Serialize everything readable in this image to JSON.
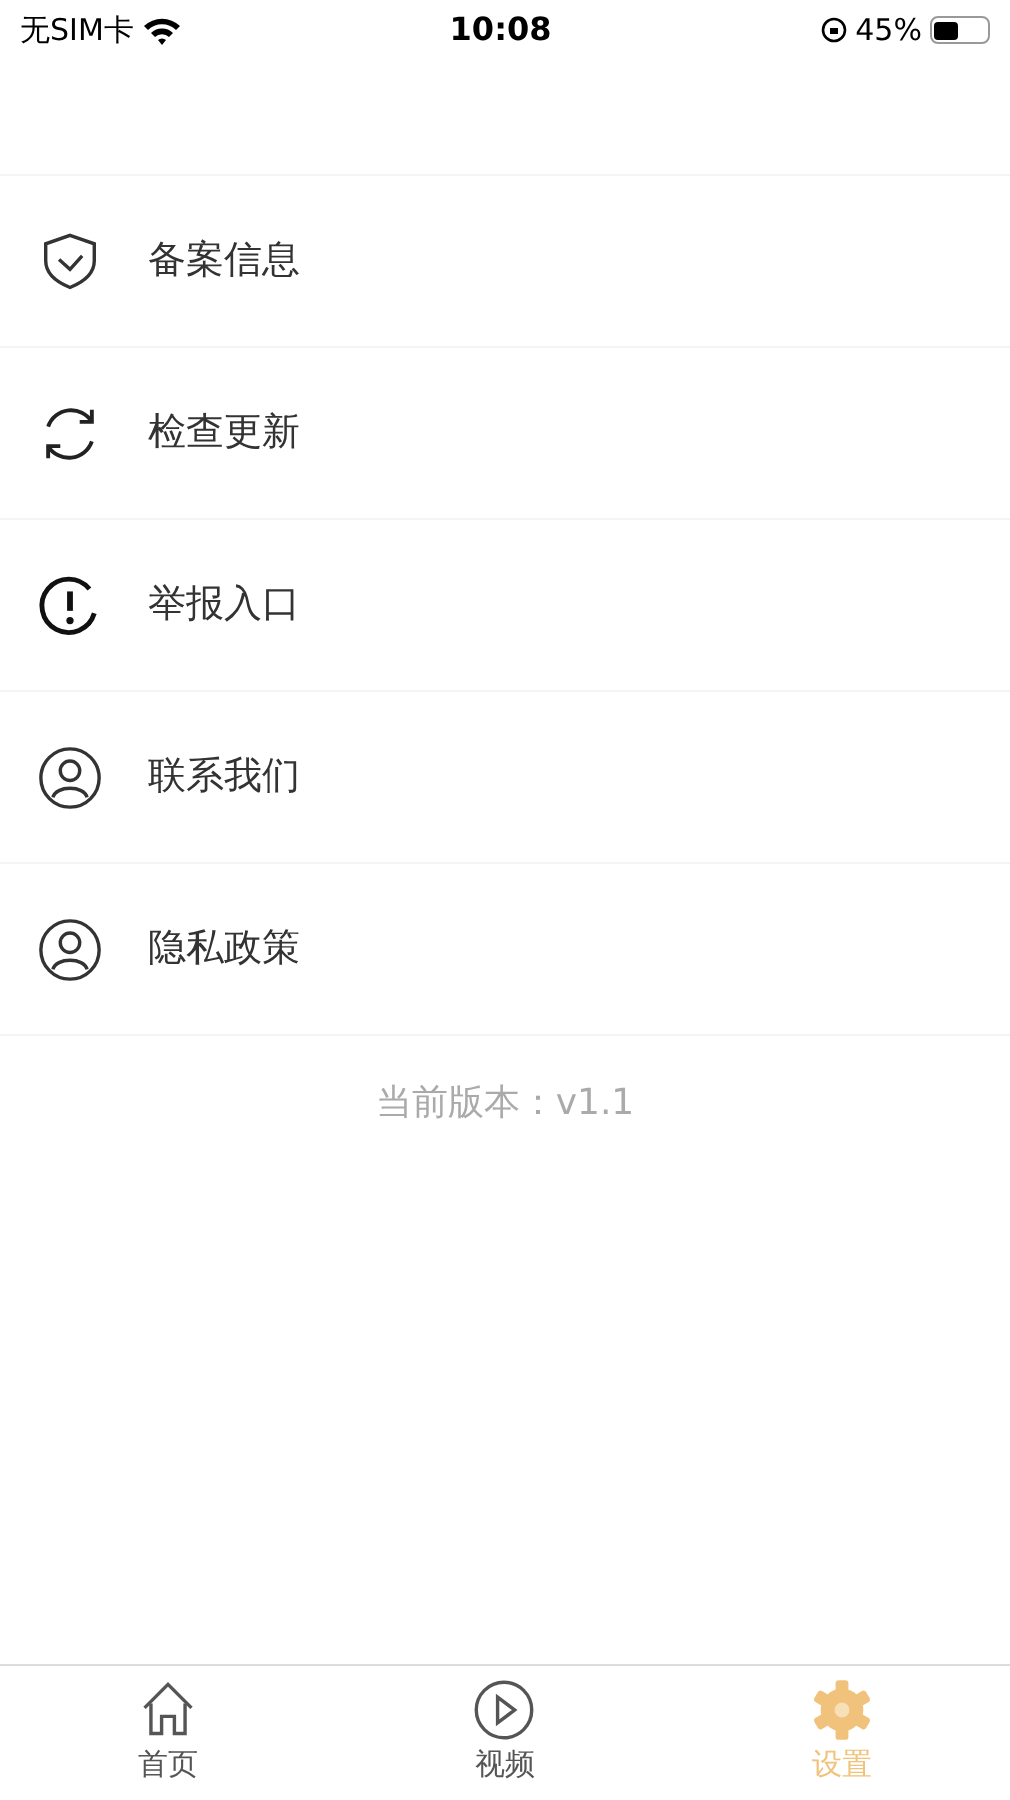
{
  "status_bar": {
    "carrier": "无SIM卡",
    "time": "10:08",
    "battery": "45%"
  },
  "menu": [
    {
      "kind": "shield",
      "label": "备案信息"
    },
    {
      "kind": "refresh",
      "label": "检查更新"
    },
    {
      "kind": "alert",
      "label": "举报入口"
    },
    {
      "kind": "person",
      "label": "联系我们"
    },
    {
      "kind": "person",
      "label": "隐私政策"
    }
  ],
  "version": "当前版本：v1.1",
  "tab_bar": [
    {
      "kind": "home",
      "label": "首页",
      "selected": false
    },
    {
      "kind": "video",
      "label": "视频",
      "selected": false
    },
    {
      "kind": "settings",
      "label": "设置",
      "selected": true
    }
  ]
}
